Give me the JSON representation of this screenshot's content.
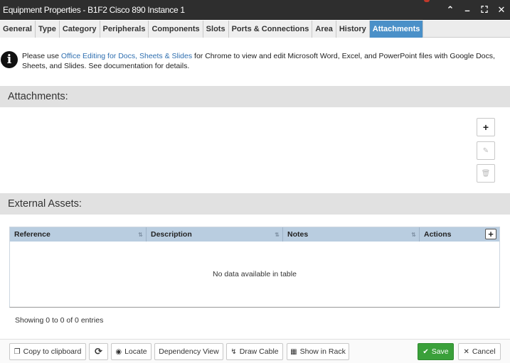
{
  "window": {
    "title": "Equipment Properties - B1F2 Cisco 890 Instance 1",
    "controls": [
      "chevron-up",
      "minimize",
      "maximize",
      "close"
    ]
  },
  "tabs": [
    {
      "label": "General"
    },
    {
      "label": "Type"
    },
    {
      "label": "Category"
    },
    {
      "label": "Peripherals"
    },
    {
      "label": "Components"
    },
    {
      "label": "Slots"
    },
    {
      "label": "Ports & Connections"
    },
    {
      "label": "Area"
    },
    {
      "label": "History"
    },
    {
      "label": "Attachments",
      "active": true
    }
  ],
  "info": {
    "prefix": "Please use ",
    "link": "Office Editing for Docs, Sheets & Slides",
    "suffix": " for Chrome to view and edit Microsoft Word, Excel, and PowerPoint files with Google Docs, Sheets, and Slides. See documentation for details."
  },
  "attachments": {
    "header": "Attachments:",
    "add_glyph": "+",
    "edit_glyph": "✎",
    "delete_glyph": "🗑"
  },
  "external_assets": {
    "header": "External Assets:",
    "columns": [
      "Reference",
      "Description",
      "Notes",
      "Actions"
    ],
    "add_glyph": "+",
    "empty_text": "No data available in table",
    "showing": "Showing 0 to 0 of 0 entries"
  },
  "footer": {
    "copy": "Copy to clipboard",
    "refresh_glyph": "⟳",
    "locate": "Locate",
    "dependency": "Dependency View",
    "draw_cable": "Draw Cable",
    "show_in_rack": "Show in Rack",
    "save": "Save",
    "cancel": "Cancel"
  },
  "colors": {
    "titlebar": "#2e2e2e",
    "active_tab": "#4a90c8",
    "save": "#3aa03a",
    "table_header": "#b9cde0"
  }
}
